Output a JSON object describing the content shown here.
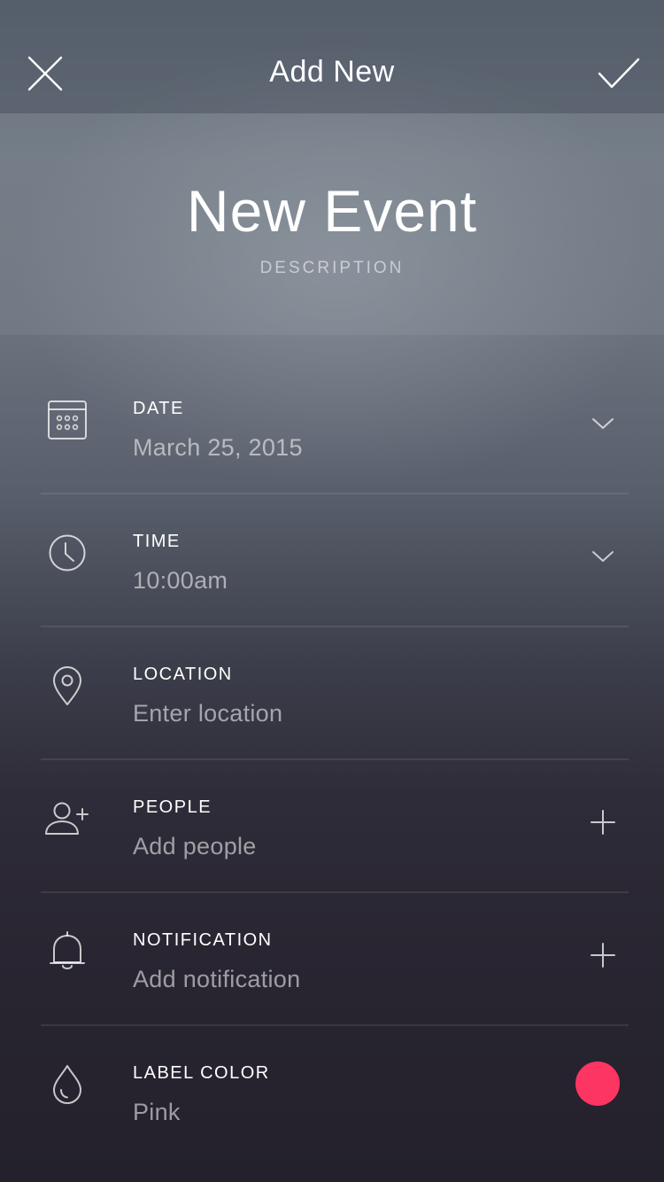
{
  "header": {
    "title": "Add New",
    "close_icon": "close-icon",
    "done_icon": "checkmark-icon"
  },
  "event": {
    "title": "New Event",
    "description_placeholder": "DESCRIPTION"
  },
  "fields": {
    "date": {
      "label": "DATE",
      "value": "March 25, 2015",
      "icon": "calendar-icon",
      "action_icon": "chevron-down-icon"
    },
    "time": {
      "label": "TIME",
      "value": "10:00am",
      "icon": "clock-icon",
      "action_icon": "chevron-down-icon"
    },
    "location": {
      "label": "LOCATION",
      "placeholder": "Enter location",
      "icon": "location-pin-icon"
    },
    "people": {
      "label": "PEOPLE",
      "placeholder": "Add people",
      "icon": "add-person-icon",
      "action_icon": "plus-icon"
    },
    "notification": {
      "label": "NOTIFICATION",
      "placeholder": "Add notification",
      "icon": "bell-icon",
      "action_icon": "plus-icon"
    },
    "label_color": {
      "label": "LABEL COLOR",
      "value": "Pink",
      "icon": "drop-icon",
      "swatch": "#fc3563"
    }
  }
}
